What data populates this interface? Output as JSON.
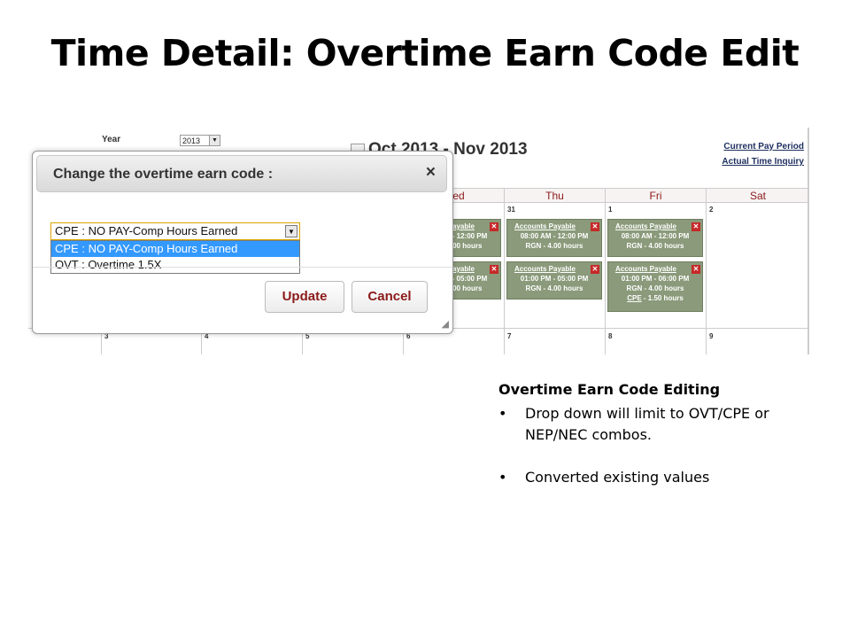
{
  "slide": {
    "title": "Time Detail: Overtime Earn Code Edit"
  },
  "calendar": {
    "year_label": "Year",
    "year_value": "2013",
    "title": "Oct 2013 - Nov 2013",
    "links": {
      "current_pay_period": "Current Pay Period",
      "actual_time_inquiry": "Actual Time Inquiry"
    },
    "days": [
      "Wed",
      "Thu",
      "Fri",
      "Sat"
    ],
    "row1_nums": [
      "31",
      "1",
      "2"
    ],
    "row2_nums": [
      "3",
      "4",
      "5",
      "6",
      "7",
      "8",
      "9"
    ],
    "events": {
      "wed1": {
        "title": "Accounts Payable",
        "time": "08:00 AM - 12:00 PM",
        "detail": "RGN - 4.00 hours"
      },
      "thu1": {
        "title": "Accounts Payable",
        "time": "08:00 AM - 12:00 PM",
        "detail": "RGN - 4.00 hours"
      },
      "fri1": {
        "title": "Accounts Payable",
        "time": "08:00 AM - 12:00 PM",
        "detail": "RGN - 4.00 hours"
      },
      "wed2": {
        "title": "Accounts Payable",
        "time": "01:00 PM - 05:00 PM",
        "detail": "RGN - 4.00 hours"
      },
      "thu2": {
        "title": "Accounts Payable",
        "time": "01:00 PM - 05:00 PM",
        "detail": "RGN - 4.00 hours"
      },
      "fri2": {
        "title": "Accounts Payable",
        "time": "01:00 PM - 06:00 PM",
        "detail": "RGN - 4.00 hours",
        "extra_code": "CPE",
        "extra_rest": " - 1.50 hours"
      }
    }
  },
  "modal": {
    "title": "Change the overtime earn code :",
    "close": "×",
    "selected": "CPE : NO PAY-Comp Hours Earned",
    "options": [
      "CPE : NO PAY-Comp Hours Earned",
      "OVT : Overtime 1.5X"
    ],
    "update_label": "Update",
    "cancel_label": "Cancel"
  },
  "notes": {
    "heading": "Overtime Earn Code Editing",
    "bullets": [
      "Drop down will limit to OVT/CPE or NEP/NEC combos.",
      "Converted existing values"
    ]
  }
}
